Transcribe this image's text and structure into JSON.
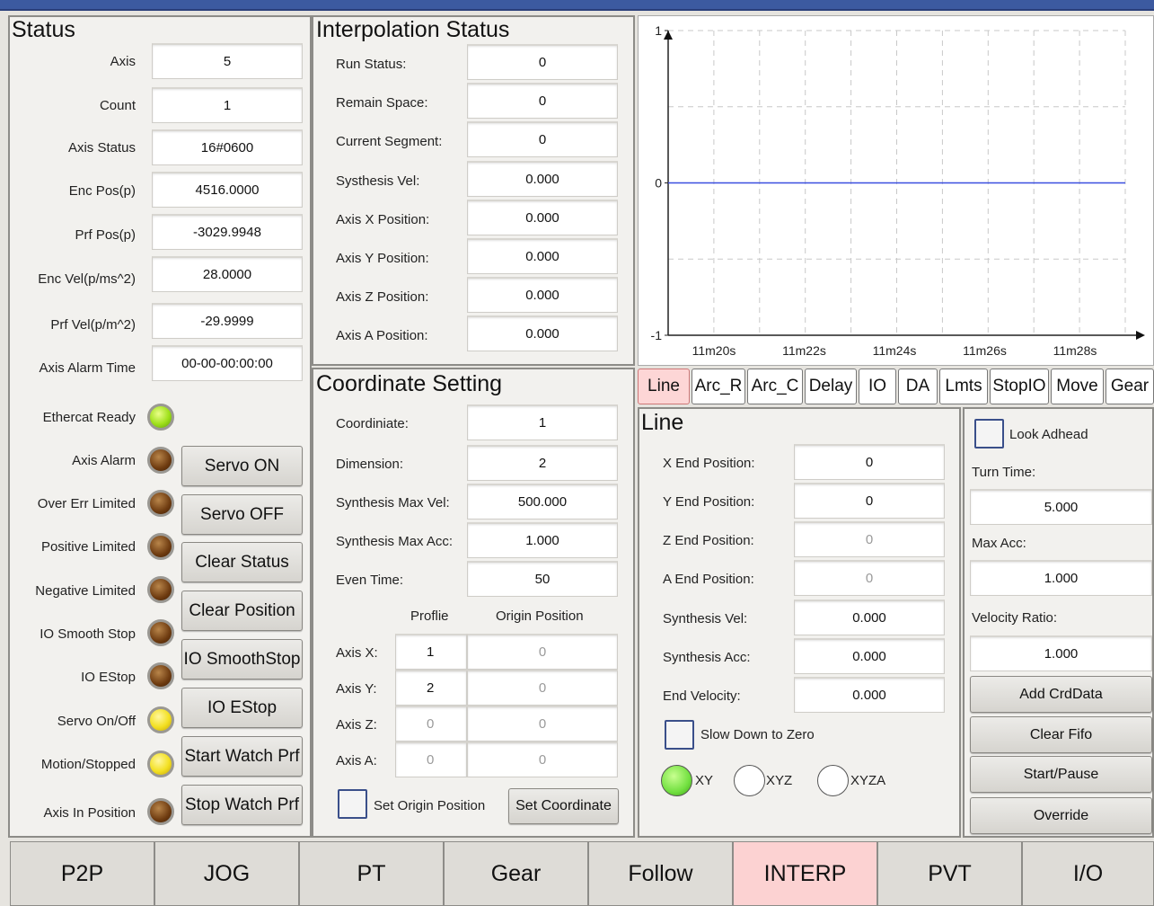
{
  "status": {
    "title": "Status",
    "fields": [
      {
        "label": "Axis",
        "value": "5"
      },
      {
        "label": "Count",
        "value": "1"
      },
      {
        "label": "Axis Status",
        "value": "16#0600"
      },
      {
        "label": "Enc Pos(p)",
        "value": "4516.0000"
      },
      {
        "label": "Prf Pos(p)",
        "value": "-3029.9948"
      },
      {
        "label": "Enc Vel(p/ms^2)",
        "value": "28.0000"
      },
      {
        "label": "Prf Vel(p/m^2)",
        "value": "-29.9999"
      },
      {
        "label": "Axis Alarm Time",
        "value": "00-00-00:00:00"
      }
    ],
    "indicators": [
      {
        "label": "Ethercat Ready",
        "state": "green"
      },
      {
        "label": "Axis Alarm",
        "state": "off"
      },
      {
        "label": "Over Err Limited",
        "state": "off"
      },
      {
        "label": "Positive Limited",
        "state": "off"
      },
      {
        "label": "Negative Limited",
        "state": "off"
      },
      {
        "label": "IO Smooth Stop",
        "state": "off"
      },
      {
        "label": "IO EStop",
        "state": "off"
      },
      {
        "label": "Servo On/Off",
        "state": "yellow"
      },
      {
        "label": "Motion/Stopped",
        "state": "yellow"
      },
      {
        "label": "Axis In Position",
        "state": "off"
      }
    ],
    "buttons": [
      "Servo ON",
      "Servo OFF",
      "Clear Status",
      "Clear Position",
      "IO SmoothStop",
      "IO EStop",
      "Start Watch Prf",
      "Stop Watch Prf"
    ]
  },
  "interp_status": {
    "title": "Interpolation Status",
    "fields": [
      {
        "label": "Run Status:",
        "value": "0"
      },
      {
        "label": "Remain Space:",
        "value": "0"
      },
      {
        "label": "Current Segment:",
        "value": "0"
      },
      {
        "label": "Systhesis Vel:",
        "value": "0.000"
      },
      {
        "label": "Axis X Position:",
        "value": "0.000"
      },
      {
        "label": "Axis Y Position:",
        "value": "0.000"
      },
      {
        "label": "Axis Z Position:",
        "value": "0.000"
      },
      {
        "label": "Axis A Position:",
        "value": "0.000"
      }
    ]
  },
  "coord": {
    "title": "Coordinate Setting",
    "fields": [
      {
        "label": "Coordiniate:",
        "value": "1"
      },
      {
        "label": "Dimension:",
        "value": "2"
      },
      {
        "label": "Synthesis Max Vel:",
        "value": "500.000"
      },
      {
        "label": "Synthesis Max Acc:",
        "value": "1.000"
      },
      {
        "label": "Even Time:",
        "value": "50"
      }
    ],
    "col_profile": "Proflie",
    "col_origin": "Origin Position",
    "axes": [
      {
        "label": "Axis X:",
        "profile": "1",
        "origin": "0"
      },
      {
        "label": "Axis Y:",
        "profile": "2",
        "origin": "0"
      },
      {
        "label": "Axis Z:",
        "profile": "0",
        "origin": "0"
      },
      {
        "label": "Axis A:",
        "profile": "0",
        "origin": "0"
      }
    ],
    "set_origin_label": "Set Origin Position",
    "set_coordinate_button": "Set Coordinate"
  },
  "chart_data": {
    "type": "line",
    "x_ticks": [
      "11m20s",
      "11m22s",
      "11m24s",
      "11m26s",
      "11m28s"
    ],
    "y_ticks": [
      "1",
      "0",
      "-1"
    ],
    "ylim": [
      -1,
      1
    ],
    "grid": true,
    "series": [
      {
        "color": "#3a4ee0",
        "values": [
          0,
          0,
          0,
          0,
          0,
          0
        ]
      }
    ]
  },
  "tabs": [
    "Line",
    "Arc_R",
    "Arc_C",
    "Delay",
    "IO",
    "DA",
    "Lmts",
    "StopIO",
    "Move",
    "Gear"
  ],
  "line": {
    "title": "Line",
    "fields": [
      {
        "label": "X End Position:",
        "value": "0",
        "disabled": false
      },
      {
        "label": "Y End Position:",
        "value": "0",
        "disabled": false
      },
      {
        "label": "Z End Position:",
        "value": "0",
        "disabled": true
      },
      {
        "label": "A End Position:",
        "value": "0",
        "disabled": true
      },
      {
        "label": "Synthesis Vel:",
        "value": "0.000",
        "disabled": false
      },
      {
        "label": "Synthesis Acc:",
        "value": "0.000",
        "disabled": false
      },
      {
        "label": "End Velocity:",
        "value": "0.000",
        "disabled": false
      }
    ],
    "slow_down_label": "Slow Down to Zero",
    "radios": [
      {
        "label": "XY",
        "selected": true
      },
      {
        "label": "XYZ",
        "selected": false
      },
      {
        "label": "XYZA",
        "selected": false
      }
    ]
  },
  "side": {
    "look_ahead_label": "Look Adhead",
    "turn_time_label": "Turn Time:",
    "turn_time_value": "5.000",
    "max_acc_label": "Max Acc:",
    "max_acc_value": "1.000",
    "velocity_ratio_label": "Velocity Ratio:",
    "velocity_ratio_value": "1.000",
    "buttons": [
      "Add CrdData",
      "Clear Fifo",
      "Start/Pause",
      "Override"
    ]
  },
  "nav": {
    "items": [
      "P2P",
      "JOG",
      "PT",
      "Gear",
      "Follow",
      "INTERP",
      "PVT",
      "I/O"
    ],
    "active": "INTERP"
  }
}
